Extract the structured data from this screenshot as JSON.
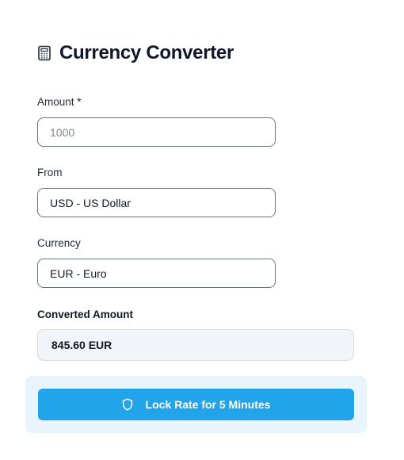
{
  "header": {
    "title": "Currency Converter",
    "icon": "calculator-icon"
  },
  "amount": {
    "label": "Amount *",
    "value": "",
    "placeholder": "1000"
  },
  "from": {
    "label": "From",
    "value": "USD - US Dollar"
  },
  "to": {
    "label": "Currency",
    "value": "EUR - Euro"
  },
  "result": {
    "label": "Converted Amount",
    "value": "845.60 EUR"
  },
  "lock": {
    "icon": "shield-icon",
    "label": "Lock Rate for 5 Minutes"
  },
  "colors": {
    "accent": "#22a4ea",
    "panel": "#eaf4fc",
    "result_bg": "#f1f4f8"
  }
}
